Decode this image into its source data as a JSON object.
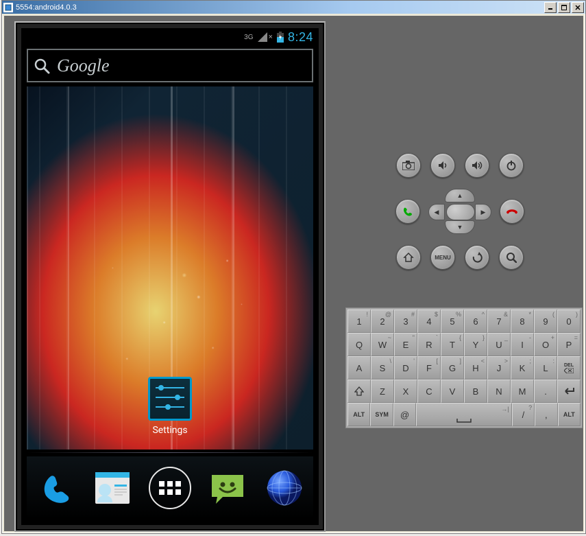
{
  "window": {
    "title": "5554:android4.0.3",
    "minimize": "_",
    "maximize": "□",
    "close": "×"
  },
  "statusbar": {
    "network_label": "3G",
    "signal_no": "×",
    "clock": "8:24"
  },
  "search": {
    "placeholder": "Google"
  },
  "home_shortcuts": [
    {
      "label": "Settings",
      "icon": "settings-sliders-icon"
    }
  ],
  "hotseat": [
    {
      "name": "phone",
      "icon": "phone-icon"
    },
    {
      "name": "contacts",
      "icon": "contacts-icon"
    },
    {
      "name": "apps",
      "icon": "app-drawer-icon"
    },
    {
      "name": "messaging",
      "icon": "messaging-icon"
    },
    {
      "name": "browser",
      "icon": "browser-icon"
    }
  ],
  "emu_controls": {
    "row1": [
      {
        "name": "camera",
        "icon": "camera-icon"
      },
      {
        "name": "volume-down",
        "icon": "volume-down-icon"
      },
      {
        "name": "volume-up",
        "icon": "volume-up-icon"
      },
      {
        "name": "power",
        "icon": "power-icon"
      }
    ],
    "row2": [
      {
        "name": "call",
        "icon": "call-icon"
      },
      {
        "name": "dpad",
        "icon": "dpad"
      },
      {
        "name": "end-call",
        "icon": "end-call-icon"
      }
    ],
    "row3": [
      {
        "name": "home",
        "icon": "home-icon"
      },
      {
        "name": "menu",
        "label": "MENU"
      },
      {
        "name": "back",
        "icon": "back-icon"
      },
      {
        "name": "search",
        "icon": "search-icon"
      }
    ]
  },
  "keyboard": {
    "rows": [
      [
        {
          "main": "1",
          "sub": "!"
        },
        {
          "main": "2",
          "sub": "@"
        },
        {
          "main": "3",
          "sub": "#"
        },
        {
          "main": "4",
          "sub": "$"
        },
        {
          "main": "5",
          "sub": "%"
        },
        {
          "main": "6",
          "sub": "^"
        },
        {
          "main": "7",
          "sub": "&"
        },
        {
          "main": "8",
          "sub": "*"
        },
        {
          "main": "9",
          "sub": "("
        },
        {
          "main": "0",
          "sub": ")"
        }
      ],
      [
        {
          "main": "Q",
          "sub": ""
        },
        {
          "main": "W",
          "sub": "~"
        },
        {
          "main": "E",
          "sub": "\""
        },
        {
          "main": "R",
          "sub": "`"
        },
        {
          "main": "T",
          "sub": "{"
        },
        {
          "main": "Y",
          "sub": "}"
        },
        {
          "main": "U",
          "sub": "_"
        },
        {
          "main": "I",
          "sub": "-"
        },
        {
          "main": "O",
          "sub": "+"
        },
        {
          "main": "P",
          "sub": "="
        }
      ],
      [
        {
          "main": "A",
          "sub": ""
        },
        {
          "main": "S",
          "sub": "\\"
        },
        {
          "main": "D",
          "sub": "'"
        },
        {
          "main": "F",
          "sub": "["
        },
        {
          "main": "G",
          "sub": "]"
        },
        {
          "main": "H",
          "sub": "<"
        },
        {
          "main": "J",
          "sub": ">"
        },
        {
          "main": "K",
          "sub": ";"
        },
        {
          "main": "L",
          "sub": ":"
        },
        {
          "main": "DEL",
          "sub": "",
          "special": "del"
        }
      ],
      [
        {
          "main": "⇧",
          "sub": "",
          "special": "shift"
        },
        {
          "main": "Z",
          "sub": ""
        },
        {
          "main": "X",
          "sub": ""
        },
        {
          "main": "C",
          "sub": ""
        },
        {
          "main": "V",
          "sub": ""
        },
        {
          "main": "B",
          "sub": ""
        },
        {
          "main": "N",
          "sub": ""
        },
        {
          "main": "M",
          "sub": ""
        },
        {
          "main": ".",
          "sub": ""
        },
        {
          "main": "↵",
          "sub": "",
          "special": "enter"
        }
      ],
      [
        {
          "main": "ALT",
          "sub": "",
          "w": "wide1_1 sm"
        },
        {
          "main": "SYM",
          "sub": "",
          "w": "wide1_1 sm"
        },
        {
          "main": "@",
          "sub": "",
          "w": "wide1_1"
        },
        {
          "main": "⌴",
          "sub": "→|",
          "w": "wide5",
          "special": "space"
        },
        {
          "main": "/",
          "sub": "?",
          "w": "wide1_1"
        },
        {
          "main": ",",
          "sub": "",
          "w": "wide1_1"
        },
        {
          "main": "ALT",
          "sub": "",
          "w": "wide1_1 sm"
        }
      ]
    ]
  }
}
